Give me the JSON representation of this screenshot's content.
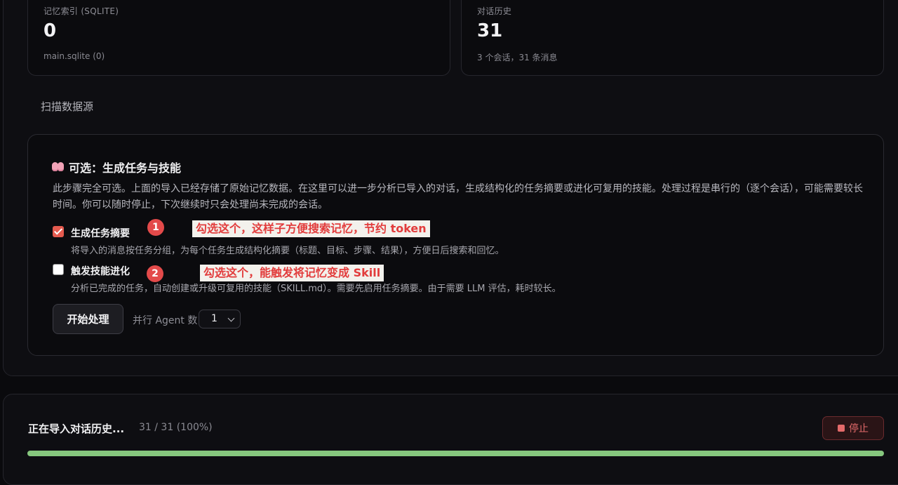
{
  "stats": [
    {
      "label": "记忆索引 (SQLITE)",
      "value": "0",
      "sub": "main.sqlite (0)"
    },
    {
      "label": "对话历史",
      "value": "31",
      "sub": "3 个会话，31 条消息"
    }
  ],
  "section_title": "扫描数据源",
  "process": {
    "title": "可选：生成任务与技能",
    "icon": "brain-icon",
    "description": "此步骤完全可选。上面的导入已经存储了原始记忆数据。在这里可以进一步分析已导入的对话，生成结构化的任务摘要或进化可复用的技能。处理过程是串行的（逐个会话），可能需要较长时间。你可以随时停止，下次继续时只会处理尚未完成的会话。",
    "options": [
      {
        "label": "生成任务摘要",
        "description": "将导入的消息按任务分组，为每个任务生成结构化摘要（标题、目标、步骤、结果），方便日后搜索和回忆。",
        "checked": true
      },
      {
        "label": "触发技能进化",
        "description": "分析已完成的任务，自动创建或升级可复用的技能（SKILL.md）。需要先启用任务摘要。由于需要 LLM 评估，耗时较长。",
        "checked": false
      }
    ],
    "start_button": "开始处理",
    "agents_label": "并行 Agent 数",
    "agents_value": "1"
  },
  "annotations": [
    {
      "number": "1",
      "text": "勾选这个，这样子方便搜索记忆，节约 token"
    },
    {
      "number": "2",
      "text": "勾选这个，能触发将记忆变成 Skill"
    }
  ],
  "import": {
    "title": "正在导入对话历史...",
    "progress_text": "31 / 31 (100%)",
    "progress_fraction": 1.0,
    "stop_button": "停止"
  },
  "colors": {
    "accent_red": "#e34a4a",
    "progress_green": "#86c77e",
    "stop_red": "#e36a6a"
  }
}
